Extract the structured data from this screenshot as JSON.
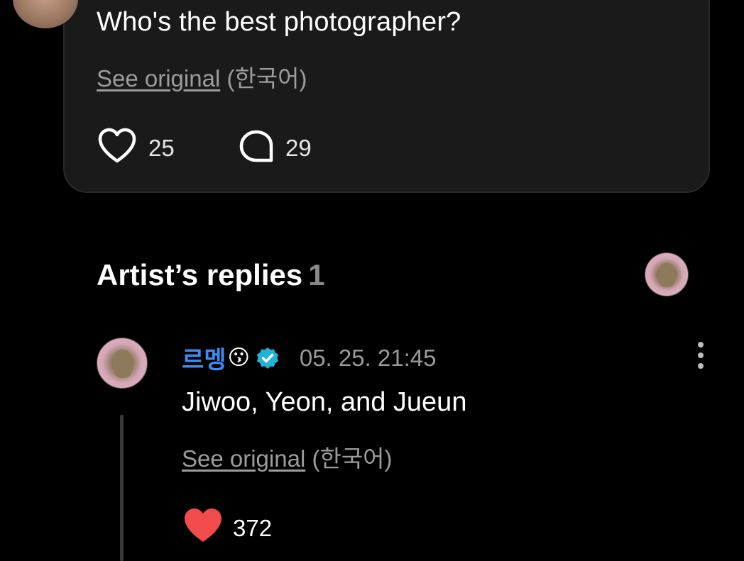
{
  "post": {
    "text": "Who's the best photographer?",
    "see_original": "See original",
    "language": "(한국어)",
    "likes": "25",
    "comments": "29"
  },
  "artist_replies": {
    "title": "Artist’s replies",
    "count": "1"
  },
  "reply": {
    "author": "르멩",
    "author_emoji": "😗",
    "timestamp": "05. 25. 21:45",
    "text": "Jiwoo, Yeon, and Jueun",
    "see_original": "See original",
    "language": "(한국어)",
    "likes": "372"
  },
  "colors": {
    "background": "#000000",
    "card": "#1a1a1a",
    "author": "#3b8df5",
    "verified": "#21b4d6",
    "liked_heart": "#f24b4b"
  },
  "icons": {
    "like": "heart-outline-icon",
    "comment": "comment-bubble-icon",
    "verified": "verified-badge-icon",
    "more": "more-vertical-icon",
    "liked": "heart-filled-icon"
  }
}
